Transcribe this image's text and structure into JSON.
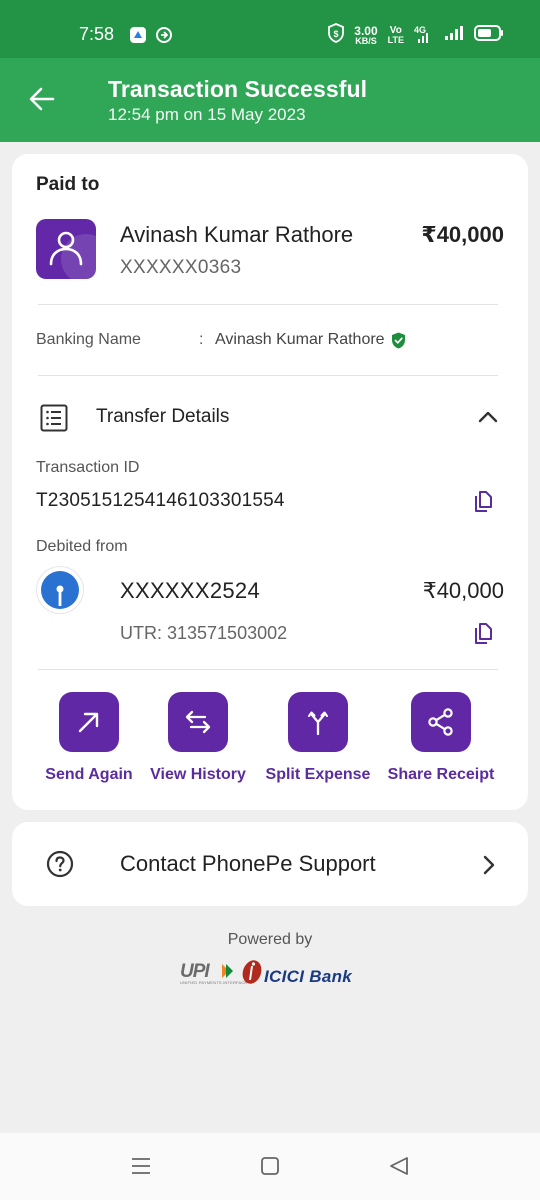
{
  "status_bar": {
    "time": "7:58",
    "network_speed_value": "3.00",
    "network_speed_unit": "KB/S",
    "volte_top": "Vo",
    "volte_bottom": "LTE",
    "network_type": "4G"
  },
  "header": {
    "title": "Transaction Successful",
    "subtitle": "12:54 pm on 15 May 2023"
  },
  "paid_to": {
    "label": "Paid to",
    "name": "Avinash Kumar Rathore",
    "account": "XXXXXX0363",
    "amount": "₹40,000"
  },
  "banking": {
    "label": "Banking Name",
    "colon": ":",
    "value": "Avinash Kumar Rathore"
  },
  "transfer": {
    "title": "Transfer Details",
    "transaction_id_label": "Transaction ID",
    "transaction_id": "T2305151254146103301554",
    "debited_from_label": "Debited from",
    "debit_account": "XXXXXX2524",
    "debit_amount": "₹40,000",
    "utr": "UTR: 313571503002"
  },
  "actions": [
    {
      "label": "Send Again",
      "icon": "arrow-up-right-icon"
    },
    {
      "label": "View History",
      "icon": "swap-arrows-icon"
    },
    {
      "label": "Split Expense",
      "icon": "split-icon"
    },
    {
      "label": "Share Receipt",
      "icon": "share-icon"
    }
  ],
  "support": {
    "label": "Contact PhonePe Support"
  },
  "footer": {
    "powered_by": "Powered by",
    "upi_logo": "UPI",
    "upi_tagline": "UNIFIED PAYMENTS INTERFACE",
    "bank_logo": "ICICI Bank"
  },
  "colors": {
    "status_bar": "#239446",
    "header": "#2fa756",
    "accent_purple": "#6128a6",
    "verified_green": "#1e8e3e"
  }
}
